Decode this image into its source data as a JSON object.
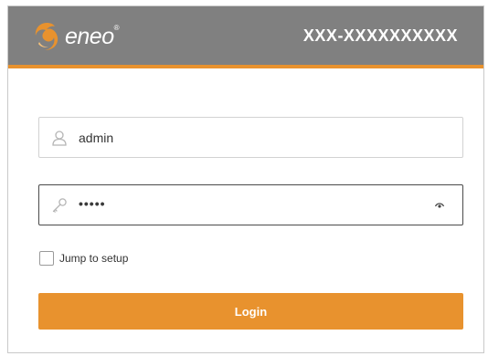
{
  "header": {
    "brand": "eneo",
    "device_name": "XXX-XXXXXXXXXX"
  },
  "login_form": {
    "username_value": "admin",
    "password_value": "•••••",
    "jump_to_setup_label": "Jump to setup",
    "jump_to_setup_checked": false,
    "login_label": "Login"
  },
  "icons": {
    "username": "user-icon",
    "password": "key-icon",
    "reveal": "eye-icon",
    "logo": "eneo-logo-icon"
  },
  "colors": {
    "accent": "#e8922e",
    "header_bg": "#808080",
    "header_text": "#ffffff"
  }
}
